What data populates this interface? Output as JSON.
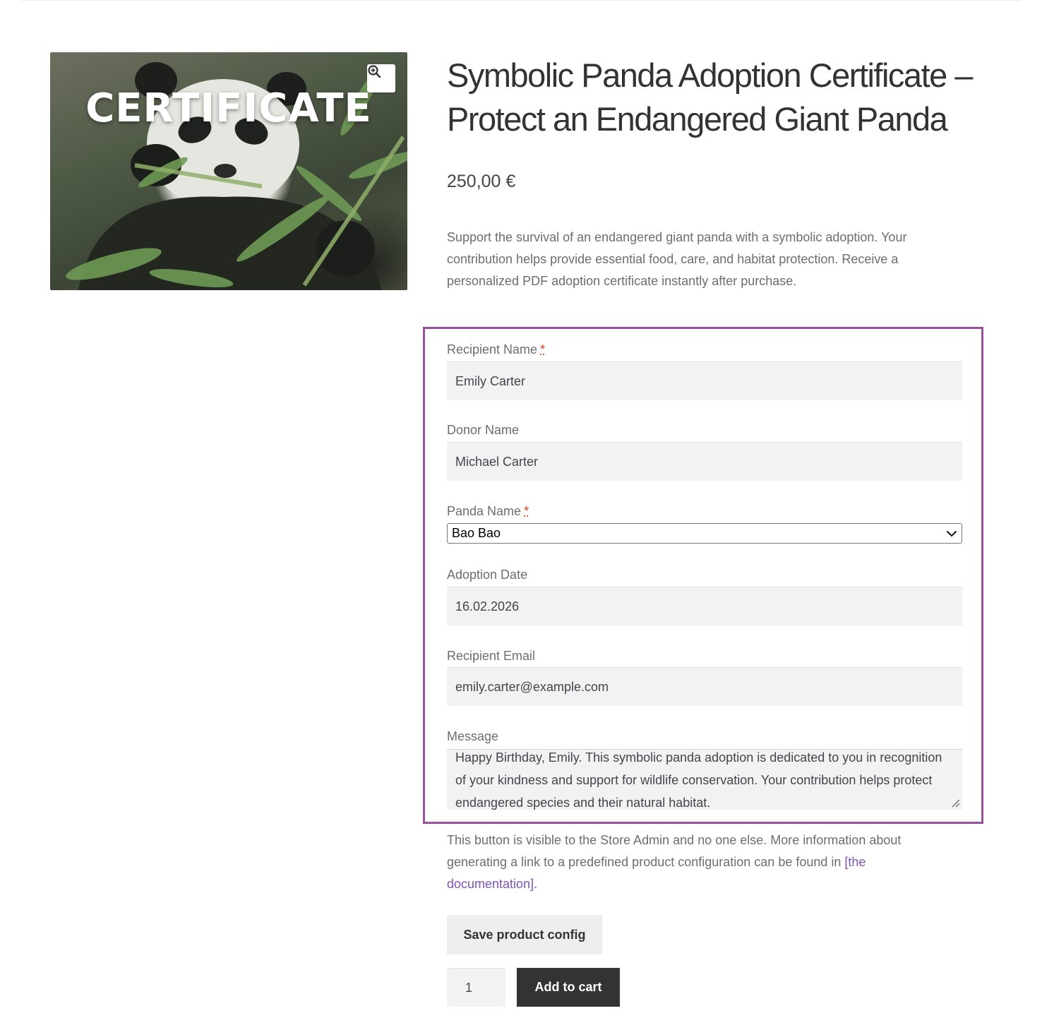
{
  "product": {
    "image": {
      "overlay_text": "CERTIFICATE",
      "zoom_icon": "zoom-in-icon"
    },
    "title": "Symbolic Panda Adoption Certificate – Protect an Endangered Giant Panda",
    "price": "250,00 €",
    "description": "Support the survival of an endangered giant panda with a symbolic adoption. Your contribution helps provide essential food, care, and habitat protection. Receive a personalized PDF adoption certificate instantly after purchase."
  },
  "form": {
    "border_color": "#96509c",
    "required_marker": "*",
    "recipient_name": {
      "label": "Recipient Name",
      "value": "Emily Carter"
    },
    "donor_name": {
      "label": "Donor Name",
      "value": "Michael Carter"
    },
    "panda_name": {
      "label": "Panda Name",
      "selected": "Bao Bao"
    },
    "adoption_date": {
      "label": "Adoption Date",
      "value": "16.02.2026"
    },
    "recipient_email": {
      "label": "Recipient Email",
      "value": "emily.carter@example.com"
    },
    "message": {
      "label": "Message",
      "value": "Happy Birthday, Emily. This symbolic panda adoption is dedicated to you in recognition of your kindness and support for wildlife conservation. Your contribution helps protect endangered species and their natural habitat."
    }
  },
  "notice": {
    "text": "This button is visible to the Store Admin and no one else. More information about generating a link to a predefined product configuration can be found in ",
    "link_text": "[the documentation].",
    "link_color": "#7f54b3"
  },
  "actions": {
    "save_label": "Save product config",
    "quantity": "1",
    "add_to_cart_label": "Add to cart"
  }
}
